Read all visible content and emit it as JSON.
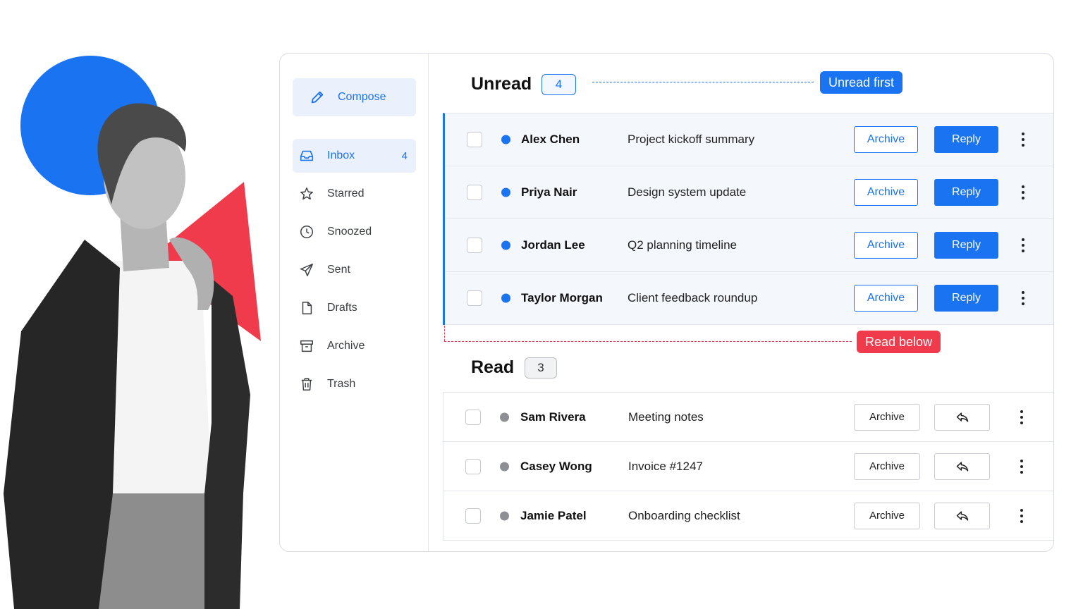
{
  "sidebar": {
    "compose_label": "Compose",
    "items": [
      {
        "label": "Inbox",
        "count": "4",
        "icon": "inbox-icon",
        "active": true
      },
      {
        "label": "Starred",
        "icon": "star-icon"
      },
      {
        "label": "Snoozed",
        "icon": "clock-icon"
      },
      {
        "label": "Sent",
        "icon": "send-icon"
      },
      {
        "label": "Drafts",
        "icon": "draft-icon"
      },
      {
        "label": "Archive",
        "icon": "archive-icon"
      },
      {
        "label": "Trash",
        "icon": "trash-icon"
      }
    ]
  },
  "unread": {
    "title": "Unread",
    "count": "4",
    "tag": "Unread first",
    "archive_label": "Archive",
    "reply_label": "Reply",
    "rows": [
      {
        "sender": "Alex Chen",
        "subject": "Project kickoff summary"
      },
      {
        "sender": "Priya Nair",
        "subject": "Design system update"
      },
      {
        "sender": "Jordan Lee",
        "subject": "Q2 planning timeline"
      },
      {
        "sender": "Taylor Morgan",
        "subject": "Client feedback roundup"
      }
    ]
  },
  "read": {
    "title": "Read",
    "count": "3",
    "tag": "Read below",
    "archive_label": "Archive",
    "rows": [
      {
        "sender": "Sam Rivera",
        "subject": "Meeting notes"
      },
      {
        "sender": "Casey Wong",
        "subject": "Invoice #1247"
      },
      {
        "sender": "Jamie Patel",
        "subject": "Onboarding checklist"
      }
    ]
  },
  "colors": {
    "accent": "#1a73f0",
    "alert": "#ef3b4b",
    "read_dot": "#8c8f94"
  }
}
